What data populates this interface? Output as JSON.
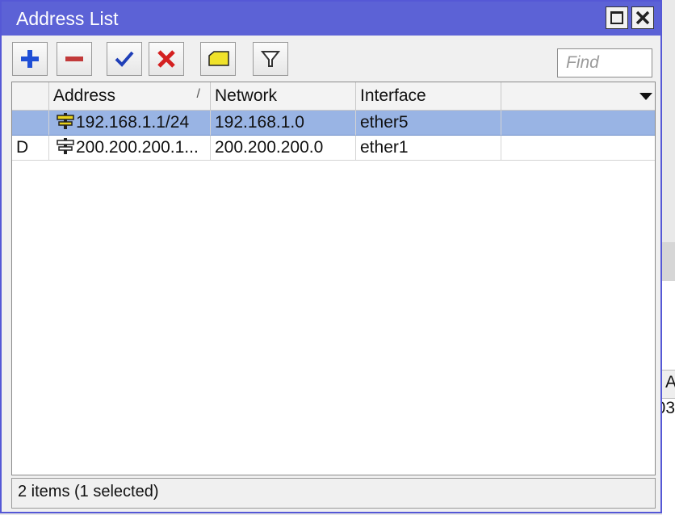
{
  "window": {
    "title": "Address List"
  },
  "toolbar": {
    "buttons": [
      "add-icon",
      "remove-icon",
      "enable-icon",
      "disable-icon",
      "comment-icon",
      "filter-icon"
    ],
    "find_placeholder": "Find"
  },
  "table": {
    "columns": [
      {
        "label": ""
      },
      {
        "label": "Address",
        "sorted": true
      },
      {
        "label": "Network"
      },
      {
        "label": "Interface"
      },
      {
        "label": ""
      }
    ],
    "sort_indicator": "/",
    "rows": [
      {
        "flag": "",
        "address": "192.168.1.1/24",
        "network": "192.168.1.0",
        "interface": "ether5",
        "selected": true
      },
      {
        "flag": "D",
        "address": "200.200.200.1...",
        "network": "200.200.200.0",
        "interface": "ether1",
        "selected": false
      }
    ]
  },
  "status": {
    "text": "2 items (1 selected)"
  },
  "background_app": {
    "fragment_header": "A",
    "fragment_value": "03"
  },
  "colors": {
    "titlebar": "#5c62d6",
    "selected_row": "#99b4e4",
    "add_icon": "#1f4fd6",
    "remove_icon": "#c23a3a",
    "enable_icon": "#1f3fb8",
    "disable_icon": "#d42020",
    "comment_icon": "#f0e22a"
  }
}
